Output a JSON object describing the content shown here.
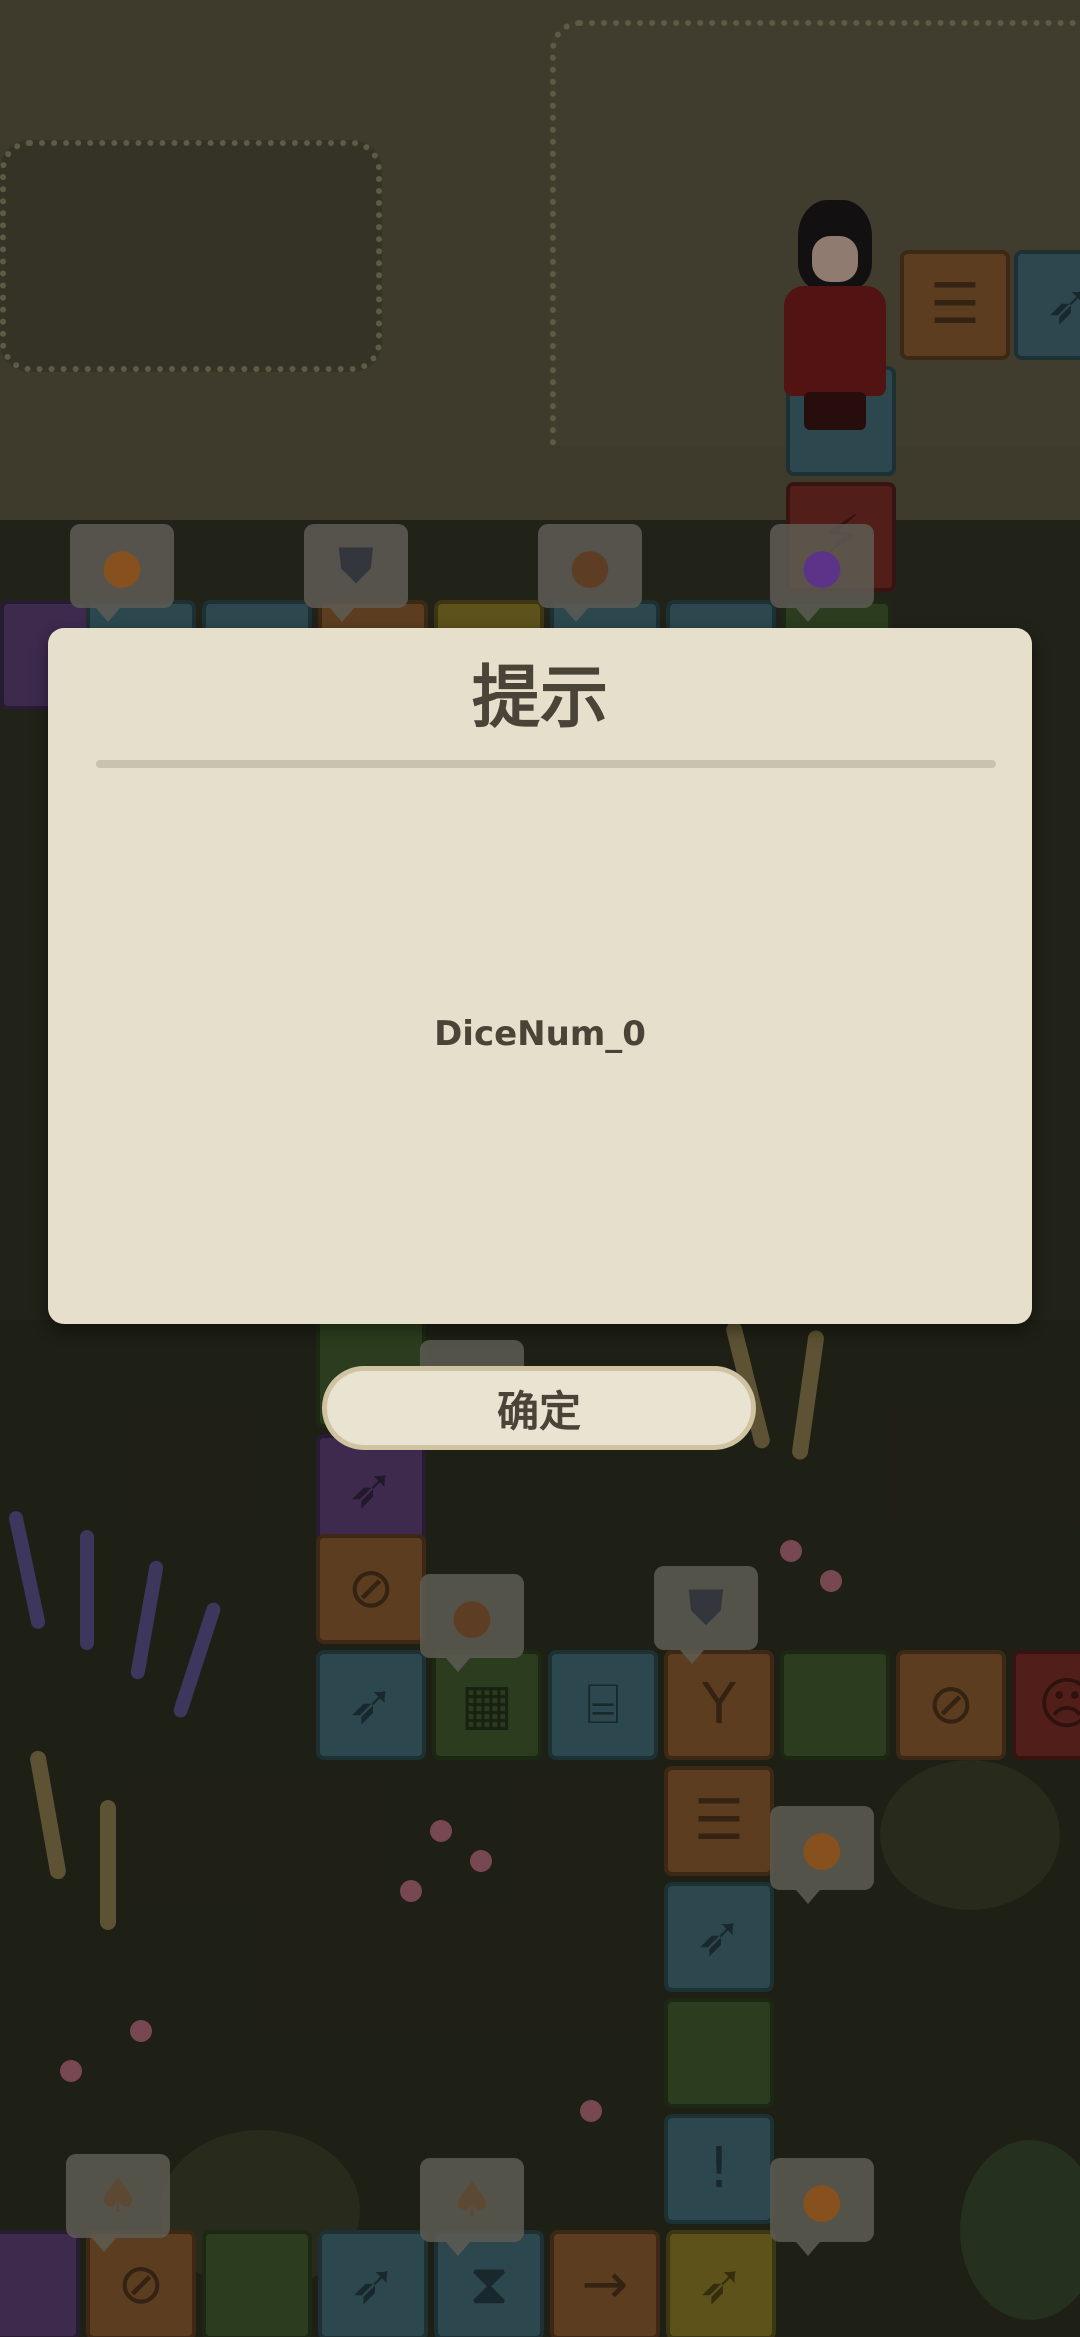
{
  "dialog": {
    "title": "提示",
    "message": "DiceNum_0",
    "confirm_label": "确定"
  },
  "board": {
    "tiles": [
      {
        "name": "tile-chat",
        "color": "orange",
        "icon": "speech-bubble-icon"
      },
      {
        "name": "tile-carrot",
        "color": "blue",
        "icon": "carrot-icon"
      },
      {
        "name": "tile-blocked",
        "color": "orange",
        "icon": "no-entry-icon"
      },
      {
        "name": "tile-gift",
        "color": "blue",
        "icon": "gift-icon"
      },
      {
        "name": "tile-fork",
        "color": "orange",
        "icon": "fork-icon"
      },
      {
        "name": "tile-surprise",
        "color": "red",
        "icon": "surprise-face-icon"
      },
      {
        "name": "tile-exclaim",
        "color": "blue",
        "icon": "exclamation-icon"
      },
      {
        "name": "tile-hourglass",
        "color": "blue",
        "icon": "hourglass-icon"
      },
      {
        "name": "tile-arrow",
        "color": "orange",
        "icon": "arrow-right-icon"
      }
    ],
    "rewards": [
      "honey-jar-icon",
      "metal-shield-icon",
      "flour-sack-icon",
      "purple-potion-icon",
      "mushroom-icon"
    ]
  },
  "colors": {
    "dialog_bg": "#e6dfcb",
    "dialog_text": "#4a4438",
    "divider": "#c9c2ae",
    "button_border": "#cfc3a2"
  }
}
